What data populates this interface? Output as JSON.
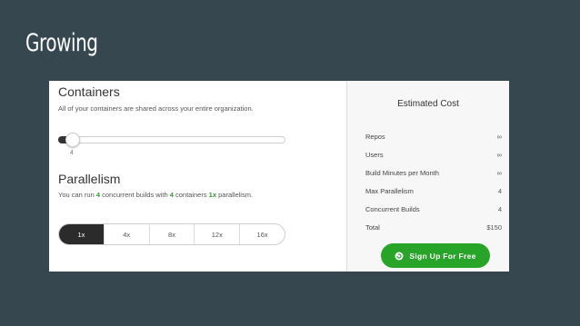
{
  "slide": {
    "title": "Growing"
  },
  "containers": {
    "heading": "Containers",
    "description": "All of your containers are shared across your entire organization.",
    "slider_value": "4"
  },
  "parallelism": {
    "heading": "Parallelism",
    "desc_pre": "You can run ",
    "desc_count": "4",
    "desc_mid": " concurrent builds with ",
    "desc_containers": "4",
    "desc_mid2": " containers ",
    "desc_factor": "1x",
    "desc_post": " parallelism.",
    "options": [
      "1x",
      "4x",
      "8x",
      "12x",
      "16x"
    ],
    "selected": "1x"
  },
  "estimate": {
    "title": "Estimated Cost",
    "rows": [
      {
        "label": "Repos",
        "value": "∞"
      },
      {
        "label": "Users",
        "value": "∞"
      },
      {
        "label": "Build Minutes per Month",
        "value": "∞"
      },
      {
        "label": "Max Parallelism",
        "value": "4"
      },
      {
        "label": "Concurrent Builds",
        "value": "4"
      },
      {
        "label": "Total",
        "value": "$150"
      }
    ],
    "signup_label": "Sign Up For Free"
  },
  "colors": {
    "accent_green": "#28a428",
    "background": "#37474f"
  }
}
